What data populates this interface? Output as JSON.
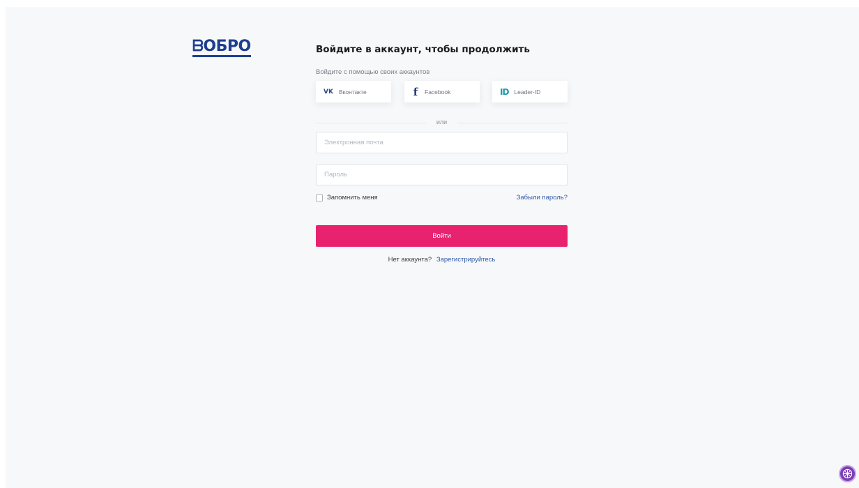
{
  "logo": {
    "text": "ᗷОБРО",
    "color": "#1e3f8f"
  },
  "login": {
    "title": "Войдите в аккаунт, чтобы продолжить",
    "social_prompt": "Войдите с помощью своих аккаунтов",
    "social": [
      {
        "label": "Вконтакте",
        "icon": "vk-icon",
        "glyph": "VK"
      },
      {
        "label": "Facebook",
        "icon": "facebook-icon",
        "glyph": "f"
      },
      {
        "label": "Leader-ID",
        "icon": "leader-id-icon",
        "glyph": "ID"
      }
    ],
    "divider_text": "или",
    "email_placeholder": "Электронная почта",
    "password_placeholder": "Пароль",
    "remember_label": "Запомнить меня",
    "forgot_link": "Забыли пароль?",
    "submit_label": "Войти",
    "no_account_text": "Нет аккаунта?",
    "register_link": "Зарегистрируйтесь"
  },
  "colors": {
    "accent": "#e8226f",
    "link": "#2f5aa8",
    "background": "#f7f8fa"
  },
  "widget": {
    "icon": "accessibility-widget-icon"
  }
}
